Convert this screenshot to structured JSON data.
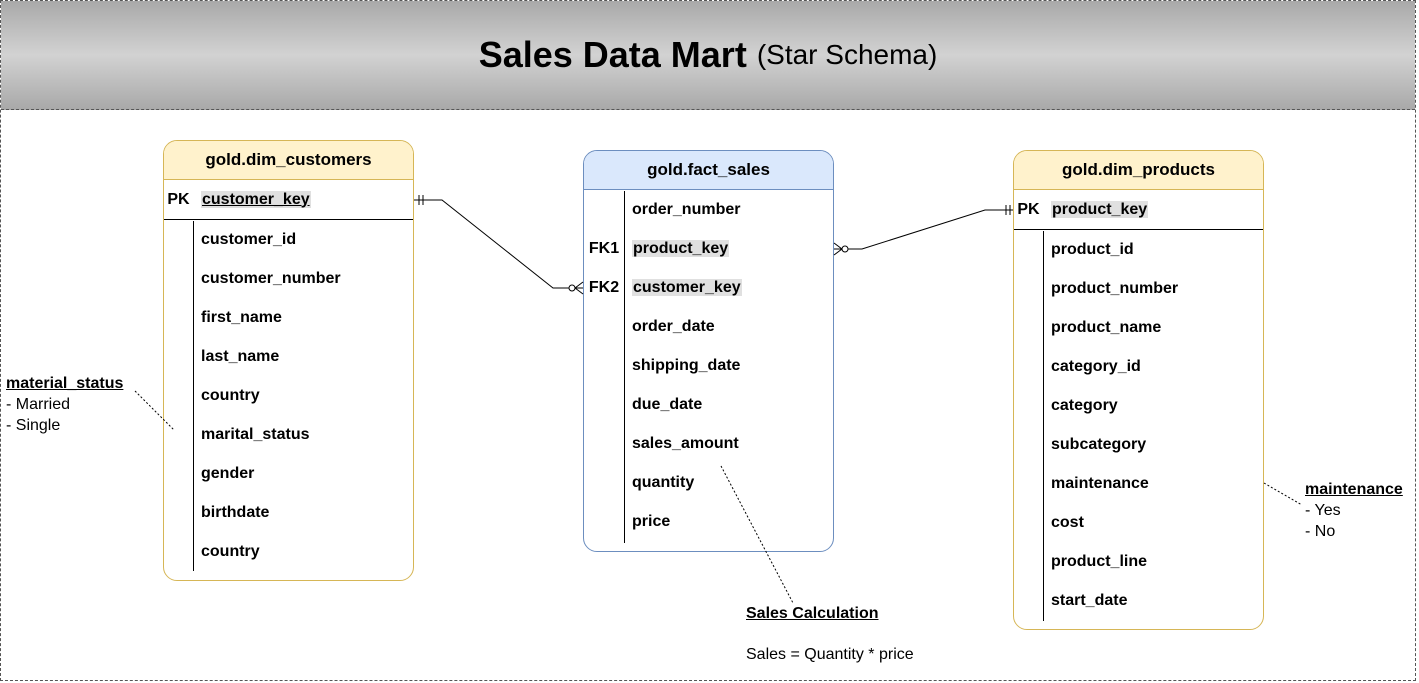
{
  "header": {
    "title": "Sales Data Mart",
    "subtitle": "(Star Schema)"
  },
  "dim_customers": {
    "name": "gold.dim_customers",
    "pk": {
      "key": "PK",
      "field": "customer_key"
    },
    "fields": [
      "customer_id",
      "customer_number",
      "first_name",
      "last_name",
      "country",
      "marital_status",
      "gender",
      "birthdate",
      "country"
    ]
  },
  "fact_sales": {
    "name": "gold.fact_sales",
    "rows": [
      {
        "key": "",
        "field": "order_number",
        "highlight": false
      },
      {
        "key": "FK1",
        "field": "product_key",
        "highlight": true
      },
      {
        "key": "FK2",
        "field": "customer_key",
        "highlight": true
      },
      {
        "key": "",
        "field": "order_date",
        "highlight": false
      },
      {
        "key": "",
        "field": "shipping_date",
        "highlight": false
      },
      {
        "key": "",
        "field": "due_date",
        "highlight": false
      },
      {
        "key": "",
        "field": "sales_amount",
        "highlight": false
      },
      {
        "key": "",
        "field": "quantity",
        "highlight": false
      },
      {
        "key": "",
        "field": "price",
        "highlight": false
      }
    ]
  },
  "dim_products": {
    "name": "gold.dim_products",
    "pk": {
      "key": "PK",
      "field": "product_key"
    },
    "fields": [
      "product_id",
      "product_number",
      "product_name",
      "category_id",
      "category",
      "subcategory",
      "maintenance",
      "cost",
      "product_line",
      "start_date"
    ]
  },
  "notes": {
    "marital": {
      "title": "material_status",
      "lines": [
        "- Married",
        "- Single"
      ]
    },
    "maintenance": {
      "title": "maintenance",
      "lines": [
        "- Yes",
        "-  No"
      ]
    },
    "sales": {
      "title": "Sales Calculation",
      "formula": "Sales = Quantity * price"
    }
  },
  "colors": {
    "dim_header": "#fff2cc",
    "dim_border": "#d6b656",
    "fact_header": "#dae8fc",
    "fact_border": "#6c8ebf"
  }
}
